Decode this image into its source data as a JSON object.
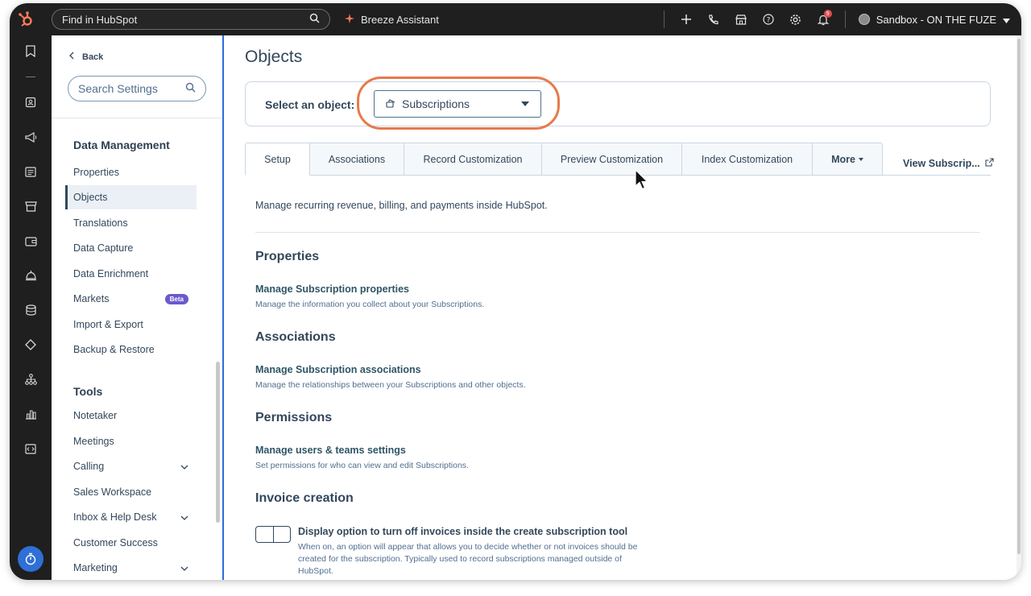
{
  "topbar": {
    "search_placeholder": "Find in HubSpot",
    "assistant_label": "Breeze Assistant",
    "notification_count": "9",
    "account_name": "Sandbox - ON THE FUZE"
  },
  "sidebar": {
    "back_label": "Back",
    "search_placeholder": "Search Settings",
    "section_data": "Data Management",
    "items_data": [
      {
        "label": "Properties"
      },
      {
        "label": "Objects"
      },
      {
        "label": "Translations"
      },
      {
        "label": "Data Capture"
      },
      {
        "label": "Data Enrichment"
      },
      {
        "label": "Markets",
        "badge": "Beta"
      },
      {
        "label": "Import & Export"
      },
      {
        "label": "Backup & Restore"
      }
    ],
    "section_tools": "Tools",
    "items_tools": [
      {
        "label": "Notetaker"
      },
      {
        "label": "Meetings"
      },
      {
        "label": "Calling"
      },
      {
        "label": "Sales Workspace"
      },
      {
        "label": "Inbox & Help Desk"
      },
      {
        "label": "Customer Success"
      },
      {
        "label": "Marketing"
      }
    ]
  },
  "main": {
    "title": "Objects",
    "select_label": "Select an object:",
    "selected_object": "Subscriptions",
    "tabs": [
      {
        "label": "Setup"
      },
      {
        "label": "Associations"
      },
      {
        "label": "Record Customization"
      },
      {
        "label": "Preview Customization"
      },
      {
        "label": "Index Customization"
      },
      {
        "label": "More"
      }
    ],
    "view_link": "View Subscrip...",
    "description": "Manage recurring revenue, billing, and payments inside HubSpot.",
    "sections": [
      {
        "title": "Properties",
        "link": "Manage Subscription properties",
        "desc": "Manage the information you collect about your Subscriptions."
      },
      {
        "title": "Associations",
        "link": "Manage Subscription associations",
        "desc": "Manage the relationships between your Subscriptions and other objects."
      },
      {
        "title": "Permissions",
        "link": "Manage users & teams settings",
        "desc": "Set permissions for who can view and edit Subscriptions."
      }
    ],
    "invoice": {
      "title": "Invoice creation",
      "option_title": "Display option to turn off invoices inside the create subscription tool",
      "option_desc": "When on, an option will appear that allows you to decide whether or not invoices should be created for the subscription. Typically used to record subscriptions managed outside of HubSpot.",
      "toggle_on": false
    }
  },
  "colors": {
    "accent_orange": "#e8794a",
    "beta_purple": "#6a5acd",
    "sidebar_border_blue": "#2d6ddc",
    "rail_clock_blue": "#2f6fd6"
  }
}
